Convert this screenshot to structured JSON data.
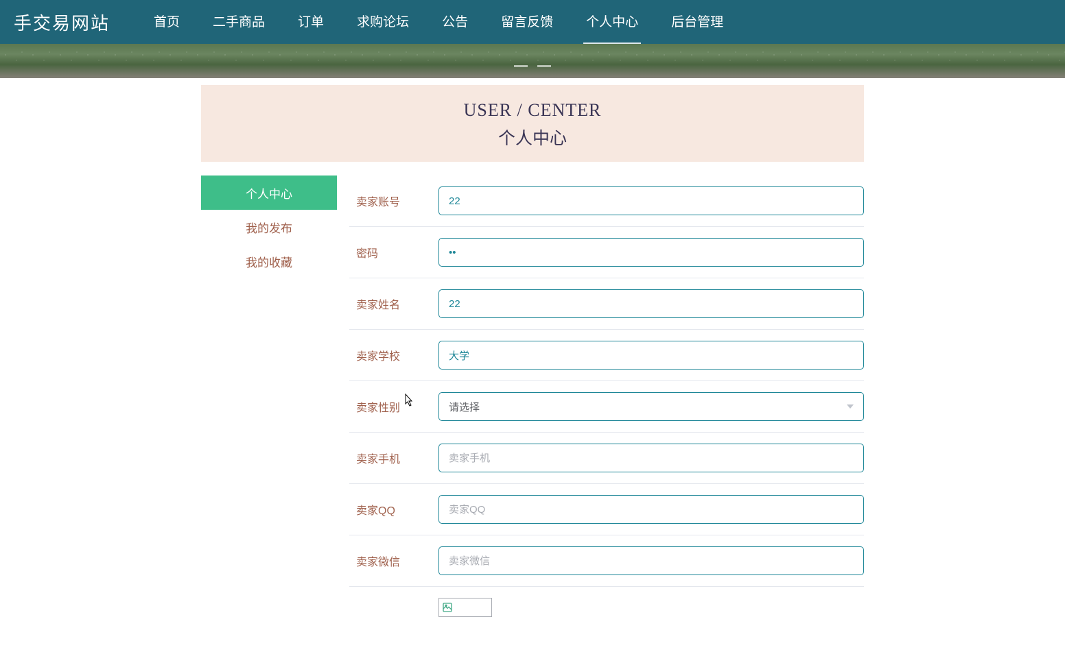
{
  "navbar": {
    "logo": "手交易网站",
    "items": [
      {
        "label": "首页"
      },
      {
        "label": "二手商品"
      },
      {
        "label": "订单"
      },
      {
        "label": "求购论坛"
      },
      {
        "label": "公告"
      },
      {
        "label": "留言反馈"
      },
      {
        "label": "个人中心"
      },
      {
        "label": "后台管理"
      }
    ],
    "activeIndex": 6
  },
  "pageHeader": {
    "titleEn": "USER / CENTER",
    "titleCn": "个人中心"
  },
  "sidebar": {
    "items": [
      {
        "label": "个人中心",
        "active": true
      },
      {
        "label": "我的发布",
        "active": false
      },
      {
        "label": "我的收藏",
        "active": false
      }
    ]
  },
  "form": {
    "fields": [
      {
        "label": "卖家账号",
        "value": "22",
        "type": "text",
        "name": "seller-account"
      },
      {
        "label": "密码",
        "value": "••",
        "type": "password",
        "name": "password"
      },
      {
        "label": "卖家姓名",
        "value": "22",
        "type": "text",
        "name": "seller-name"
      },
      {
        "label": "卖家学校",
        "value": "大学",
        "type": "text",
        "name": "seller-school"
      },
      {
        "label": "卖家性别",
        "value": "请选择",
        "type": "select",
        "name": "seller-gender"
      },
      {
        "label": "卖家手机",
        "value": "",
        "placeholder": "卖家手机",
        "type": "text",
        "name": "seller-phone"
      },
      {
        "label": "卖家QQ",
        "value": "",
        "placeholder": "卖家QQ",
        "type": "text",
        "name": "seller-qq"
      },
      {
        "label": "卖家微信",
        "value": "",
        "placeholder": "卖家微信",
        "type": "text",
        "name": "seller-wechat"
      }
    ]
  }
}
